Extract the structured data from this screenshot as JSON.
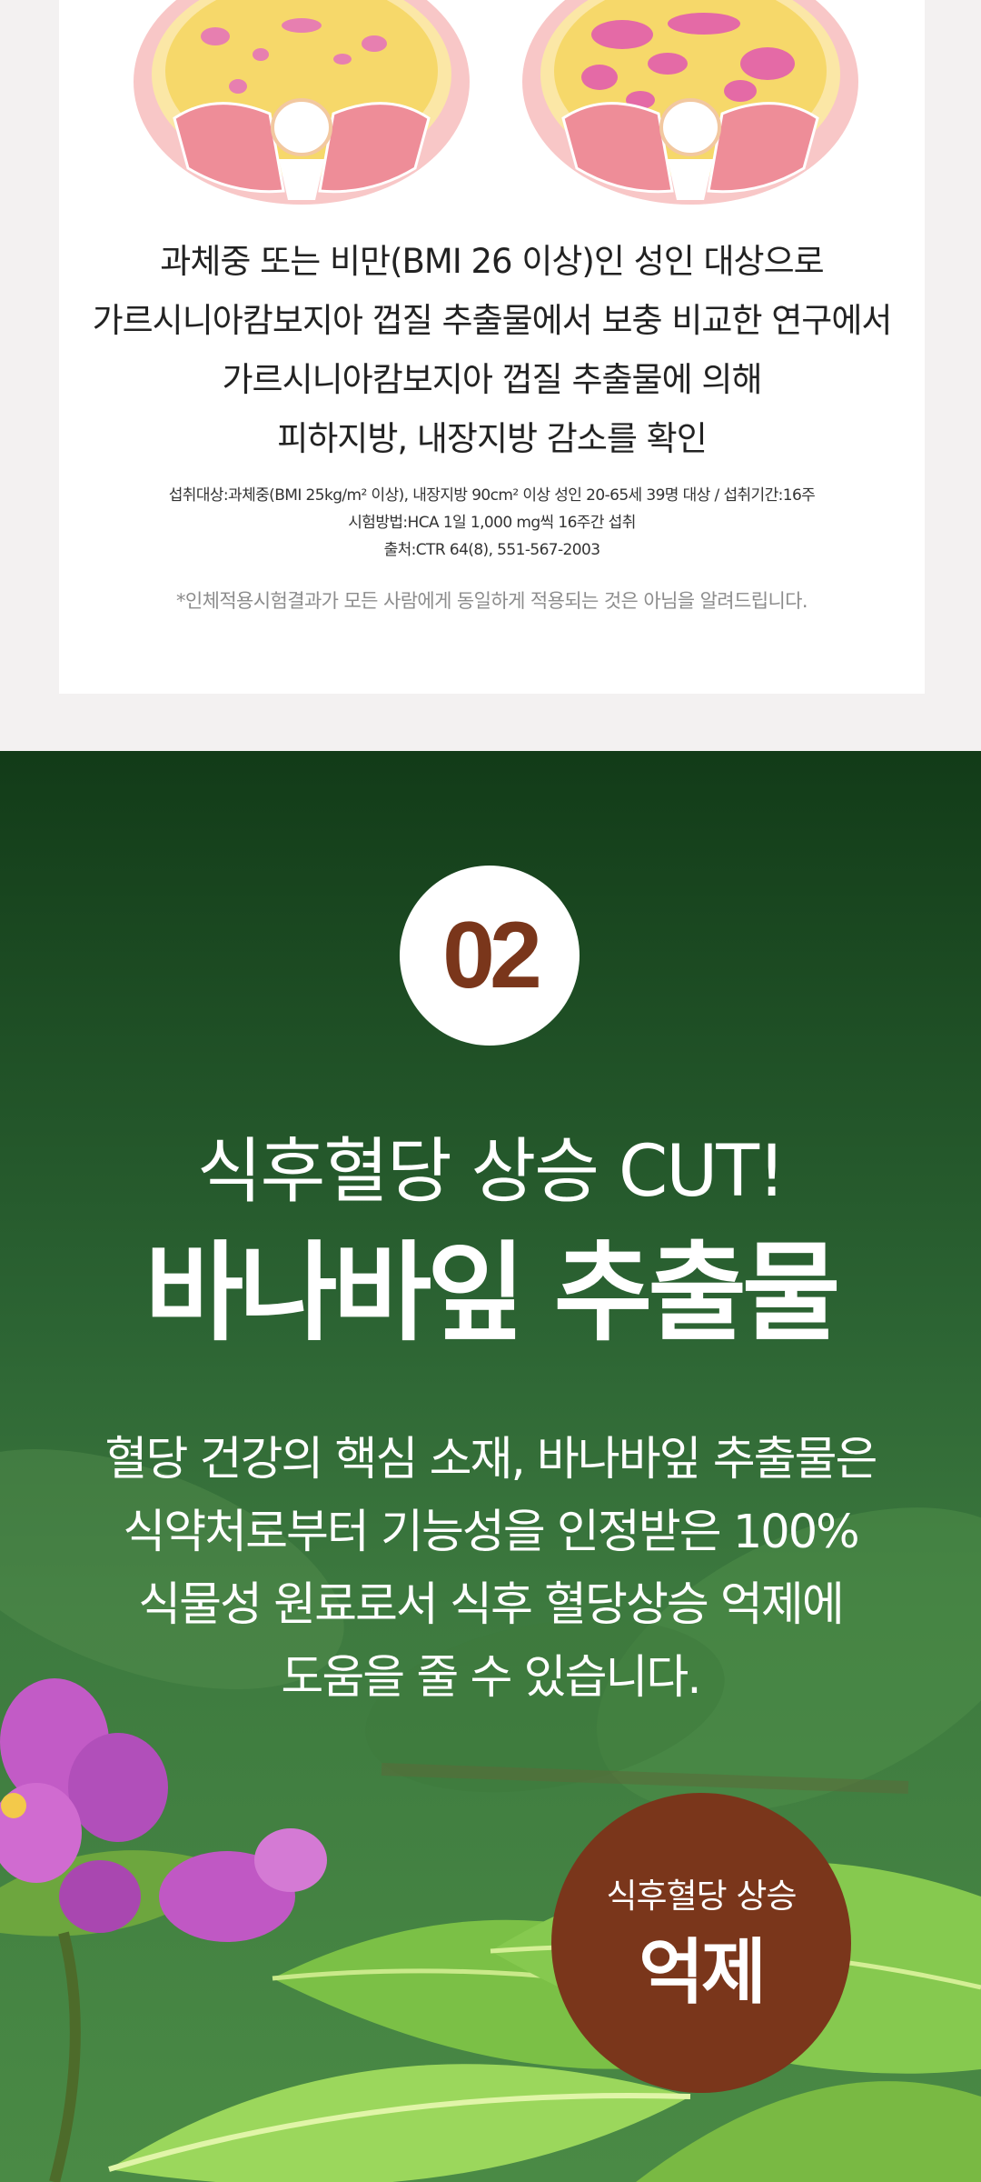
{
  "study": {
    "headline_lines": [
      "과체중 또는 비만(BMI 26 이상)인 성인 대상으로",
      "가르시니아캄보지아 껍질 추출물에서 보충 비교한 연구에서",
      "가르시니아캄보지아 껍질 추출물에 의해",
      "피하지방, 내장지방 감소를 확인"
    ],
    "reference_lines": [
      "섭취대상:과체중(BMI 25kg/m² 이상), 내장지방 90cm² 이상 성인 20-65세 39명 대상 / 섭취기간:16주",
      "시험방법:HCA 1일 1,000 mg씩 16주간 섭취",
      "출처:CTR 64(8), 551-567-2003"
    ],
    "disclaimer": "*인체적용시험결과가 모든 사람에게 동일하게 적용되는 것은 아님을 알려드립니다."
  },
  "section2": {
    "number": "02",
    "subtitle": "식후혈당 상승 CUT!",
    "title": "바나바잎 추출물",
    "description_lines": [
      "혈당 건강의 핵심 소재, 바나바잎 추출물은",
      "식약처로부터 기능성을 인정받은 100%",
      "식물성 원료로서 식후 혈당상승 억제에",
      "도움을 줄 수 있습니다."
    ],
    "badge_small": "식후혈당 상승",
    "badge_big": "억제"
  },
  "colors": {
    "accent_brown": "#7a361b",
    "green_dark": "#123b18",
    "green_light": "#4a8a45",
    "fat_pink": "#e46aa6",
    "fat_yellow": "#f6d86a"
  }
}
